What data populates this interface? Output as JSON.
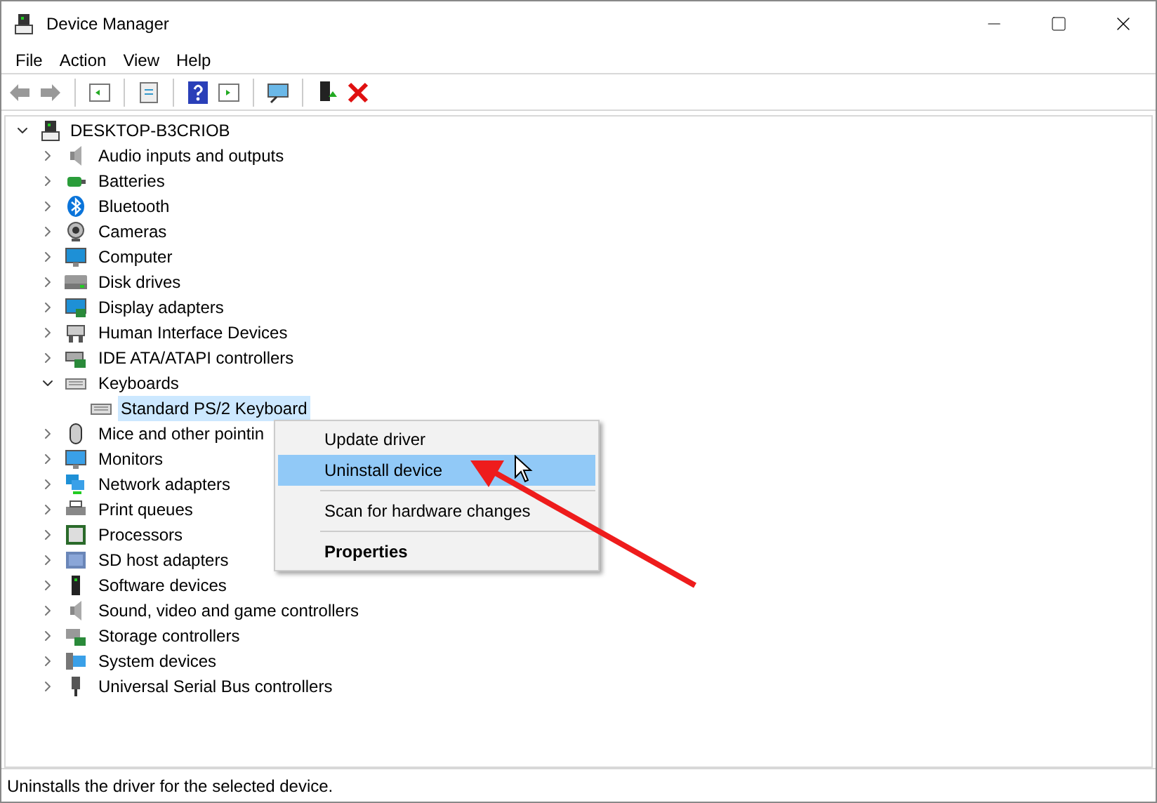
{
  "window": {
    "title": "Device Manager"
  },
  "menu_bar": [
    "File",
    "Action",
    "View",
    "Help"
  ],
  "tree": {
    "label": "DESKTOP-B3CRIOB",
    "expanded": true,
    "children": [
      {
        "label": "Audio inputs and outputs",
        "expanded": false,
        "selected": false
      },
      {
        "label": "Batteries",
        "expanded": false,
        "selected": false
      },
      {
        "label": "Bluetooth",
        "expanded": false,
        "selected": false
      },
      {
        "label": "Cameras",
        "expanded": false,
        "selected": false
      },
      {
        "label": "Computer",
        "expanded": false,
        "selected": false
      },
      {
        "label": "Disk drives",
        "expanded": false,
        "selected": false
      },
      {
        "label": "Display adapters",
        "expanded": false,
        "selected": false
      },
      {
        "label": "Human Interface Devices",
        "expanded": false,
        "selected": false
      },
      {
        "label": "IDE ATA/ATAPI controllers",
        "expanded": false,
        "selected": false
      },
      {
        "label": "Keyboards",
        "expanded": true,
        "selected": false,
        "children": [
          {
            "label": "Standard PS/2 Keyboard",
            "selected": true
          }
        ]
      },
      {
        "label": "Mice and other pointin",
        "expanded": false,
        "selected": false
      },
      {
        "label": "Monitors",
        "expanded": false,
        "selected": false
      },
      {
        "label": "Network adapters",
        "expanded": false,
        "selected": false
      },
      {
        "label": "Print queues",
        "expanded": false,
        "selected": false
      },
      {
        "label": "Processors",
        "expanded": false,
        "selected": false
      },
      {
        "label": "SD host adapters",
        "expanded": false,
        "selected": false
      },
      {
        "label": "Software devices",
        "expanded": false,
        "selected": false
      },
      {
        "label": "Sound, video and game controllers",
        "expanded": false,
        "selected": false
      },
      {
        "label": "Storage controllers",
        "expanded": false,
        "selected": false
      },
      {
        "label": "System devices",
        "expanded": false,
        "selected": false
      },
      {
        "label": "Universal Serial Bus controllers",
        "expanded": false,
        "selected": false
      }
    ]
  },
  "context_menu": [
    {
      "kind": "item",
      "label": "Update driver",
      "selected": false,
      "default": false
    },
    {
      "kind": "item",
      "label": "Uninstall device",
      "selected": true,
      "default": false
    },
    {
      "kind": "separator"
    },
    {
      "kind": "item",
      "label": "Scan for hardware changes",
      "selected": false,
      "default": false
    },
    {
      "kind": "separator"
    },
    {
      "kind": "item",
      "label": "Properties",
      "selected": false,
      "default": true
    }
  ],
  "status_bar": "Uninstalls the driver for the selected device."
}
